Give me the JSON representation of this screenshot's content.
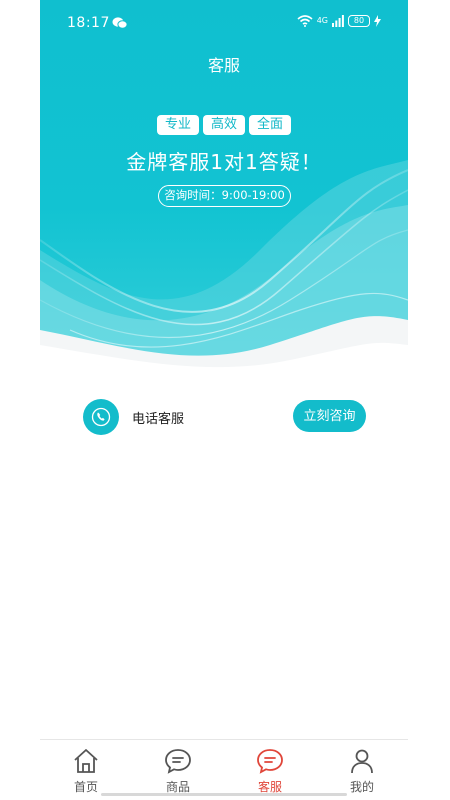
{
  "status": {
    "time": "18:17",
    "network": "4G",
    "battery": "80"
  },
  "header": {
    "title": "客服"
  },
  "banner": {
    "tags": [
      "专业",
      "高效",
      "全面"
    ],
    "headline": "金牌客服1对1答疑！",
    "hours": "咨询时间：9:00-19:00"
  },
  "contact": {
    "label": "电话客服",
    "button": "立刻咨询"
  },
  "tabs": [
    {
      "label": "首页",
      "icon": "home-icon",
      "active": false
    },
    {
      "label": "商品",
      "icon": "chat-bubble-icon",
      "active": false
    },
    {
      "label": "客服",
      "icon": "chat-bubble-icon",
      "active": true
    },
    {
      "label": "我的",
      "icon": "user-icon",
      "active": false
    }
  ],
  "colors": {
    "primary": "#13bccb",
    "active_tab": "#e0463a",
    "inactive_tab": "#555555"
  }
}
